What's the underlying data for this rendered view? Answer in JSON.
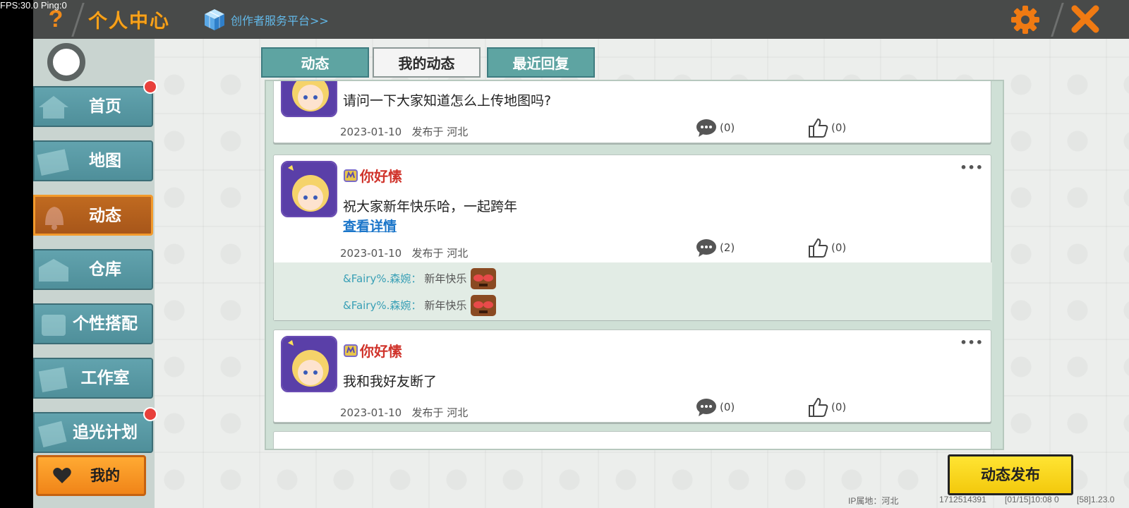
{
  "debug": {
    "fps": "FPS:30.0",
    "ping": "Ping:0"
  },
  "header": {
    "help": "?",
    "title": "个人中心",
    "creator_link": "创作者服务平台>>",
    "icons": {
      "settings": "gear-icon",
      "close": "close-icon",
      "creator": "cube-icon"
    }
  },
  "sidebar": {
    "items": [
      {
        "label": "首页",
        "icon": "house-icon",
        "active": false,
        "notification": true
      },
      {
        "label": "地图",
        "icon": "map-icon",
        "active": false,
        "notification": false
      },
      {
        "label": "动态",
        "icon": "bell-icon",
        "active": true,
        "notification": false
      },
      {
        "label": "仓库",
        "icon": "warehouse-icon",
        "active": false,
        "notification": false
      },
      {
        "label": "个性搭配",
        "icon": "outfit-icon",
        "active": false,
        "notification": false
      },
      {
        "label": "工作室",
        "icon": "studio-icon",
        "active": false,
        "notification": false
      },
      {
        "label": "追光计划",
        "icon": "light-plan-icon",
        "active": false,
        "notification": true
      }
    ],
    "mine_label": "我的"
  },
  "tabs": [
    {
      "label": "动态",
      "selected": false
    },
    {
      "label": "我的动态",
      "selected": true
    },
    {
      "label": "最近回复",
      "selected": false
    }
  ],
  "posts": [
    {
      "author": "",
      "text": "请问一下大家知道怎么上传地图吗?",
      "date": "2023-01-10",
      "location": "发布于 河北",
      "comments": "(0)",
      "likes": "(0)"
    },
    {
      "author": "你好愫",
      "text": "祝大家新年快乐哈，一起跨年",
      "detail_link": "查看详情",
      "date": "2023-01-10",
      "location": "发布于 河北",
      "comments": "(2)",
      "likes": "(0)",
      "replies": [
        {
          "who": "&Fairy%.森婉：",
          "text": "新年快乐"
        },
        {
          "who": "&Fairy%.森婉：",
          "text": "新年快乐"
        }
      ]
    },
    {
      "author": "你好愫",
      "text": "我和我好友断了",
      "date": "2023-01-10",
      "location": "发布于 河北",
      "comments": "(0)",
      "likes": "(0)"
    }
  ],
  "publish_label": "动态发布",
  "footer": {
    "ip": "IP属地：河北",
    "uid": "1712514391",
    "time": "[01/15]10:08 0",
    "version": "[58]1.23.0"
  },
  "colors": {
    "accent_orange": "#f7a11b",
    "tab_teal": "#5ea4a2",
    "author_red": "#d0342c",
    "link_blue": "#1a75c9",
    "publish_yellow": "#ffe433"
  }
}
